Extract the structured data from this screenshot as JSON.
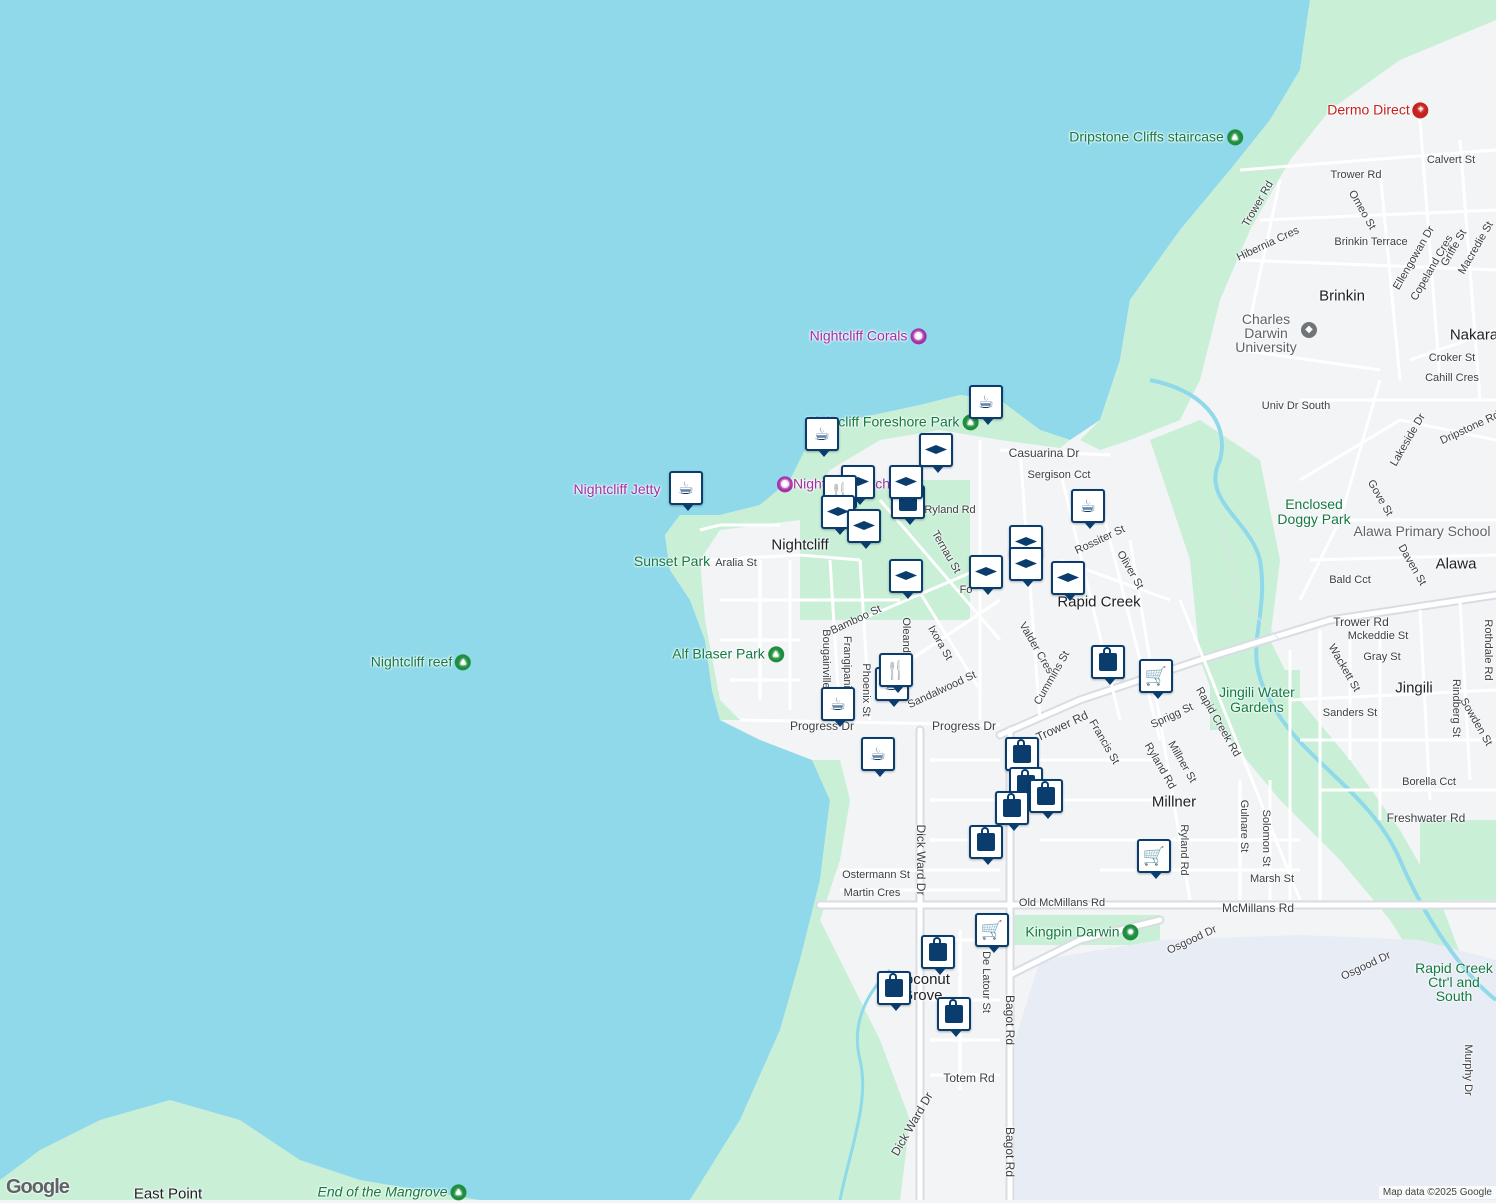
{
  "map": {
    "colors": {
      "water": "#8fd9ea",
      "land": "#f3f4f6",
      "park": "#c9efd7",
      "road": "#ffffff",
      "major_road": "#d9dde3",
      "industrial": "#e8ecf4",
      "pin_border": "#0a3d6e"
    },
    "suburbs": [
      {
        "id": "nightcliff",
        "label": "Nightcliff"
      },
      {
        "id": "rapid-creek",
        "label": "Rapid Creek"
      },
      {
        "id": "millner",
        "label": "Millner"
      },
      {
        "id": "brinkin",
        "label": "Brinkin"
      },
      {
        "id": "nakara",
        "label": "Nakara"
      },
      {
        "id": "alawa",
        "label": "Alawa"
      },
      {
        "id": "jingili",
        "label": "Jingili"
      },
      {
        "id": "coconut-grove",
        "label": "Coconut Grove"
      },
      {
        "id": "east-point",
        "label": "East Point"
      }
    ],
    "places": [
      {
        "id": "dermo-direct",
        "label": "Dermo Direct",
        "icon": "medical-icon"
      },
      {
        "id": "dripstone-cliffs",
        "label": "Dripstone Cliffs staircase",
        "icon": "tree-icon"
      },
      {
        "id": "nightcliff-corals",
        "label": "Nightcliff Corals",
        "icon": "camera-icon"
      },
      {
        "id": "foreshore-park",
        "label": "Nightcliff Foreshore Park",
        "icon": "tree-icon"
      },
      {
        "id": "nightcliff-jetty",
        "label": "Nightcliff Jetty",
        "icon": "camera-icon"
      },
      {
        "id": "nightcliff-beach",
        "label": "Nightcliff Beach",
        "icon": "camera-icon"
      },
      {
        "id": "sunset-park",
        "label": "Sunset Park",
        "icon": ""
      },
      {
        "id": "alf-blaser-park",
        "label": "Alf Blaser Park",
        "icon": "tree-icon"
      },
      {
        "id": "nightcliff-reef",
        "label": "Nightcliff reef",
        "icon": "tree-icon"
      },
      {
        "id": "charles-darwin-uni",
        "label": "Charles Darwin University",
        "icon": "school-icon"
      },
      {
        "id": "enclosed-doggy-park",
        "label": "Enclosed Doggy Park",
        "icon": ""
      },
      {
        "id": "alawa-primary",
        "label": "Alawa Primary School",
        "icon": ""
      },
      {
        "id": "jingili-water-gardens",
        "label": "Jingili Water Gardens",
        "icon": ""
      },
      {
        "id": "kingpin-darwin",
        "label": "Kingpin Darwin",
        "icon": "bowling-icon"
      },
      {
        "id": "rapid-creek-ctrl",
        "label": "Rapid Creek Ctr'l and South",
        "icon": ""
      },
      {
        "id": "end-of-mangrove",
        "label": "End of the Mangrove",
        "icon": "tree-icon"
      }
    ],
    "streets": [
      "Aralia St",
      "Bamboo St",
      "Bougainvillea",
      "Frangipani",
      "Phoenix St",
      "Oleander",
      "Ixora St",
      "Sandalwood St",
      "Progress Dr",
      "Progress Dr",
      "Casuarina Dr",
      "Sergison Cct",
      "Ryland Rd",
      "Ternau St",
      "Rossiter St",
      "Oliver St",
      "Valder Cres",
      "Cummins St",
      "Francis St",
      "Trower Rd",
      "Sprigg St",
      "Ryland Rd",
      "Millner St",
      "Rapid Creek Rd",
      "Ryland Rd",
      "Gulnare St",
      "Solomon St",
      "Marsh St",
      "Freshwater Rd",
      "Borella Cct",
      "Sanders St",
      "Rindberg St",
      "Sowden St",
      "Wackett St",
      "Gray St",
      "Mckeddie St",
      "Trower Rd",
      "Rothdale Rd",
      "Bald Cct",
      "Daven St",
      "Gove St",
      "Lakeside Dr",
      "Dripstone Rd",
      "Univ Dr South",
      "Cahill Cres",
      "Croker St",
      "Ellengowan Dr",
      "Copeland Cres",
      "Griffe St",
      "Macredie St",
      "Brinkin Terrace",
      "Hibernia Cres",
      "Omeo St",
      "Trower Rd",
      "Trower Rd",
      "Calvert St",
      "Dick Ward Dr",
      "Dick Ward Dr",
      "Ostermann St",
      "Martin Cres",
      "Old McMillans Rd",
      "McMillans Rd",
      "Osgood Dr",
      "Osgood Dr",
      "De Latour St",
      "Bagot Rd",
      "Bagot Rd",
      "Totem Rd",
      "Murphy Dr",
      "Fo"
    ],
    "markers": [
      {
        "type": "cafe"
      },
      {
        "type": "cafe"
      },
      {
        "type": "cafe"
      },
      {
        "type": "school"
      },
      {
        "type": "school"
      },
      {
        "type": "shop"
      },
      {
        "type": "restaurant"
      },
      {
        "type": "school"
      },
      {
        "type": "school"
      },
      {
        "type": "school"
      },
      {
        "type": "school"
      },
      {
        "type": "school"
      },
      {
        "type": "school"
      },
      {
        "type": "school"
      },
      {
        "type": "cafe"
      },
      {
        "type": "cafe"
      },
      {
        "type": "cafe"
      },
      {
        "type": "shop"
      },
      {
        "type": "grocery"
      },
      {
        "type": "cafe"
      },
      {
        "type": "school"
      },
      {
        "type": "shop"
      },
      {
        "type": "shop"
      },
      {
        "type": "shop"
      },
      {
        "type": "shop"
      },
      {
        "type": "shop"
      },
      {
        "type": "grocery"
      },
      {
        "type": "grocery"
      },
      {
        "type": "shop"
      },
      {
        "type": "shop"
      },
      {
        "type": "shop"
      },
      {
        "type": "restaurant"
      }
    ],
    "attribution": "Map data ©2025 Google",
    "logo": "Google"
  }
}
